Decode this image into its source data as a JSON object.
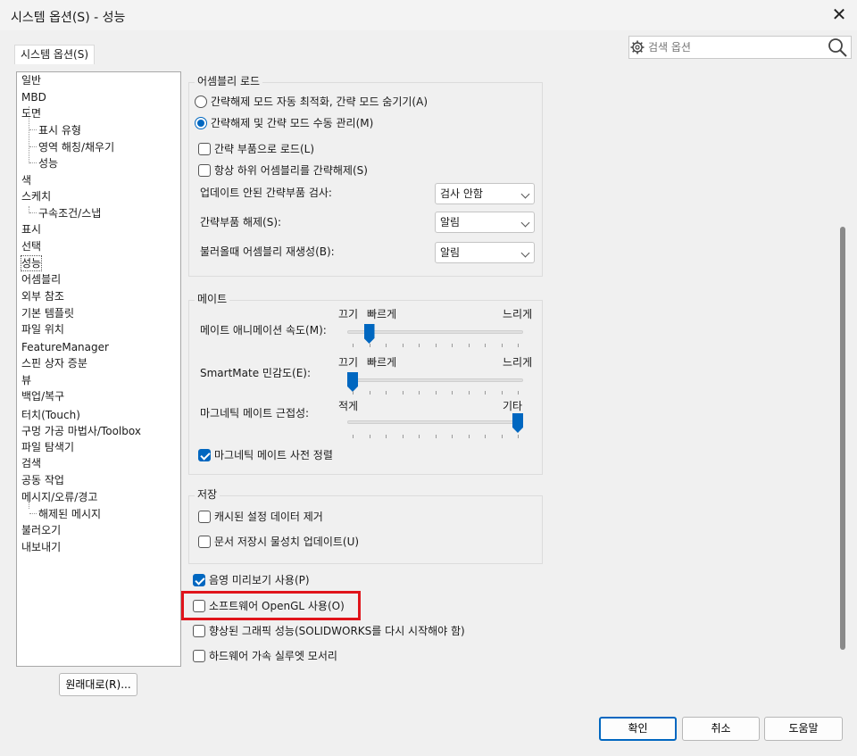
{
  "window": {
    "title": "시스템 옵션(S) - 성능"
  },
  "tab": {
    "label": "시스템 옵션(S)"
  },
  "search": {
    "placeholder": "검색 옵션"
  },
  "tree": [
    {
      "label": "일반"
    },
    {
      "label": "MBD"
    },
    {
      "label": "도면"
    },
    {
      "label": "표시 유형"
    },
    {
      "label": "영역 해칭/채우기"
    },
    {
      "label": "성능"
    },
    {
      "label": "색"
    },
    {
      "label": "스케치"
    },
    {
      "label": "구속조건/스냅"
    },
    {
      "label": "표시"
    },
    {
      "label": "선택"
    },
    {
      "label": "성능"
    },
    {
      "label": "어셈블리"
    },
    {
      "label": "외부 참조"
    },
    {
      "label": "기본 템플릿"
    },
    {
      "label": "파일 위치"
    },
    {
      "label": "FeatureManager"
    },
    {
      "label": "스핀 상자 증분"
    },
    {
      "label": "뷰"
    },
    {
      "label": "백업/복구"
    },
    {
      "label": "터치(Touch)"
    },
    {
      "label": "구멍 가공 마법사/Toolbox"
    },
    {
      "label": "파일 탐색기"
    },
    {
      "label": "검색"
    },
    {
      "label": "공동 작업"
    },
    {
      "label": "메시지/오류/경고"
    },
    {
      "label": "해제된 메시지"
    },
    {
      "label": "불러오기"
    },
    {
      "label": "내보내기"
    }
  ],
  "restore_button": "원래대로(R)...",
  "assembly_load": {
    "title": "어셈블리 로드",
    "radio_auto": "간략해제 모드 자동 최적화, 간략 모드 숨기기(A)",
    "radio_manual": "간략해제 및 간략 모드 수동 관리(M)",
    "check_lightweight": "간략 부품으로 로드(L)",
    "check_always_resolve": "항상 하위 어셈블리를 간략해제(S)",
    "row_check_label": "업데이트 안된 간략부품 검사:",
    "row_check_value": "검사 안함",
    "row_resolve_label": "간략부품 해제(S):",
    "row_resolve_value": "알림",
    "row_rebuild_label": "불러올때 어셈블리 재생성(B):",
    "row_rebuild_value": "알림"
  },
  "mate": {
    "title": "메이트",
    "anim_label": "메이트 애니메이션 속도(M):",
    "anim_off": "끄기",
    "anim_fast": "빠르게",
    "anim_slow": "느리게",
    "anim_level": 0.1,
    "smart_label": "SmartMate 민감도(E):",
    "smart_off": "끄기",
    "smart_fast": "빠르게",
    "smart_slow": "느리게",
    "smart_level": 0.0,
    "magnetic_label": "마그네틱 메이트 근접성:",
    "magnetic_low": "적게",
    "magnetic_high": "기타",
    "magnetic_level": 1.0,
    "check_presort": "마그네틱 메이트 사전 정렬"
  },
  "save": {
    "title": "저장",
    "check_purge": "캐시된 설정 데이터 제거",
    "check_mass_props": "문서 저장시 물성치 업데이트(U)"
  },
  "options": {
    "shaded_preview": "음영 미리보기 사용(P)",
    "software_opengl": "소프트웨어 OpenGL 사용(O)",
    "enhanced_graphics": "향상된 그래픽 성능(SOLIDWORKS를 다시 시작해야 함)",
    "hw_silhouette": "하드웨어 가속 실루엣 모서리"
  },
  "buttons": {
    "ok": "확인",
    "cancel": "취소",
    "help": "도움말"
  },
  "colors": {
    "accent": "#0067c0",
    "highlight": "#e0141b"
  }
}
